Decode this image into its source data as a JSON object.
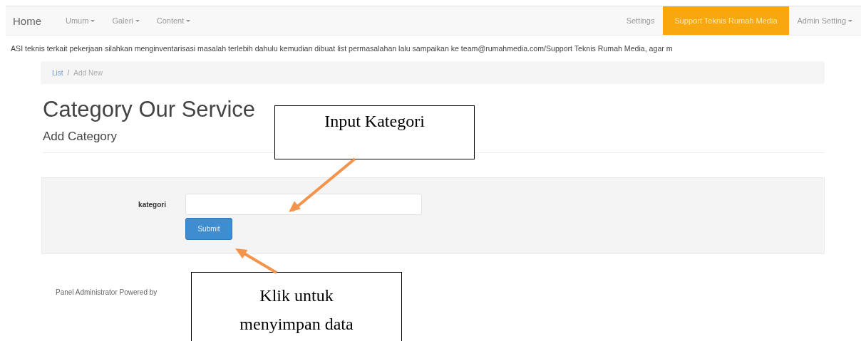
{
  "navbar": {
    "brand": "Home",
    "left_items": [
      {
        "label": "Umum",
        "dropdown": true
      },
      {
        "label": "Galeri",
        "dropdown": true
      },
      {
        "label": "Content",
        "dropdown": true
      }
    ],
    "right_items": [
      {
        "label": "Settings",
        "dropdown": false,
        "selected": false
      },
      {
        "label": "Support Teknis Rumah Media",
        "dropdown": false,
        "selected": true
      },
      {
        "label": "Admin Setting",
        "dropdown": true,
        "selected": false
      }
    ]
  },
  "notice": "ASI teknis terkait pekerjaan silahkan menginventarisasi masalah terlebih dahulu kemudian dibuat list permasalahan lalu sampaikan ke team@rumahmedia.com/Support Teknis Rumah Media, agar m",
  "breadcrumb": {
    "separator": "/",
    "items": [
      {
        "label": "List",
        "active": false
      },
      {
        "label": "Add New",
        "active": true
      }
    ]
  },
  "page_title": "Category Our Service",
  "section_title": "Add Category",
  "form": {
    "field_label": "kategori",
    "submit": "Submit"
  },
  "footer": "Panel Administrator Powered by",
  "callouts": [
    {
      "text": "Input Kategori",
      "kind": "field"
    },
    {
      "text": "Klik untuk menyimpan data",
      "kind": "button"
    }
  ]
}
